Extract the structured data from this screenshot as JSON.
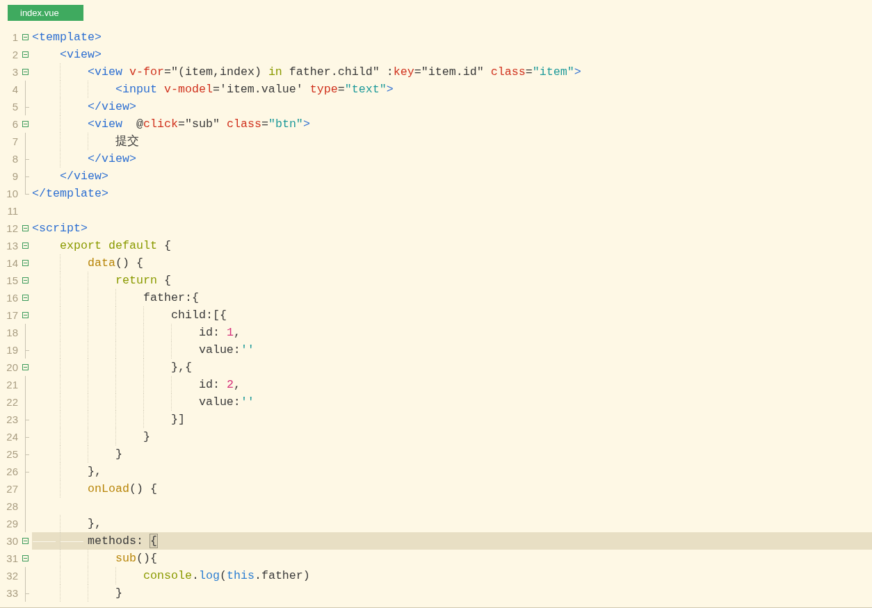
{
  "tab": {
    "label": "index.vue",
    "selected": true
  },
  "lines": [
    {
      "number": "1",
      "kind": "fold-start",
      "selected": false,
      "tokens": [
        {
          "kind": "tag",
          "text": "<template>"
        }
      ]
    },
    {
      "number": "2",
      "kind": "fold-start",
      "selected": false,
      "tokens": [
        {
          "kind": "tag",
          "text": "    <view>"
        }
      ]
    },
    {
      "number": "3",
      "kind": "fold-start",
      "selected": false,
      "tokens": [
        {
          "kind": "tag",
          "text": "        <view"
        },
        {
          "kind": "attr",
          "text": " v-for"
        },
        {
          "kind": "plain",
          "text": "=\"(item,index) "
        },
        {
          "kind": "keyword",
          "text": "in"
        },
        {
          "kind": "plain",
          "text": " father.child\" :"
        },
        {
          "kind": "attr",
          "text": "key"
        },
        {
          "kind": "plain",
          "text": "=\"item.id\" "
        },
        {
          "kind": "attr",
          "text": "class"
        },
        {
          "kind": "plain",
          "text": "="
        },
        {
          "kind": "string",
          "text": "\"item\""
        },
        {
          "kind": "tag",
          "text": ">"
        }
      ]
    },
    {
      "number": "4",
      "kind": "fold-inner",
      "selected": false,
      "tokens": [
        {
          "kind": "tag",
          "text": "            <input"
        },
        {
          "kind": "attr",
          "text": " v-model"
        },
        {
          "kind": "plain",
          "text": "='item.value' "
        },
        {
          "kind": "attr",
          "text": "type"
        },
        {
          "kind": "plain",
          "text": "="
        },
        {
          "kind": "string",
          "text": "\"text\""
        },
        {
          "kind": "tag",
          "text": ">"
        }
      ]
    },
    {
      "number": "5",
      "kind": "fold-end",
      "selected": false,
      "tokens": [
        {
          "kind": "tag",
          "text": "        </view>"
        }
      ]
    },
    {
      "number": "6",
      "kind": "fold-start",
      "selected": false,
      "tokens": [
        {
          "kind": "tag",
          "text": "        <view"
        },
        {
          "kind": "plain",
          "text": "  @"
        },
        {
          "kind": "attr",
          "text": "click"
        },
        {
          "kind": "plain",
          "text": "=\"sub\" "
        },
        {
          "kind": "attr",
          "text": "class"
        },
        {
          "kind": "plain",
          "text": "="
        },
        {
          "kind": "string",
          "text": "\"btn\""
        },
        {
          "kind": "tag",
          "text": ">"
        }
      ]
    },
    {
      "number": "7",
      "kind": "fold-inner",
      "selected": false,
      "tokens": [
        {
          "kind": "plain",
          "text": "            提交"
        }
      ]
    },
    {
      "number": "8",
      "kind": "fold-end",
      "selected": false,
      "tokens": [
        {
          "kind": "tag",
          "text": "        </view>"
        }
      ]
    },
    {
      "number": "9",
      "kind": "fold-end",
      "selected": false,
      "tokens": [
        {
          "kind": "tag",
          "text": "    </view>"
        }
      ]
    },
    {
      "number": "10",
      "kind": "fold-last",
      "selected": false,
      "tokens": [
        {
          "kind": "tag",
          "text": "</template>"
        }
      ]
    },
    {
      "number": "11",
      "kind": "blank",
      "selected": false
    },
    {
      "number": "12",
      "kind": "fold-start",
      "selected": false,
      "tokens": [
        {
          "kind": "tag",
          "text": "<script>"
        }
      ]
    },
    {
      "number": "13",
      "kind": "fold-start",
      "selected": false,
      "tokens": [
        {
          "kind": "keyword",
          "text": "    export default"
        },
        {
          "kind": "plain",
          "text": " {"
        }
      ]
    },
    {
      "number": "14",
      "kind": "fold-start",
      "selected": false,
      "tokens": [
        {
          "kind": "func",
          "text": "        data"
        },
        {
          "kind": "plain",
          "text": "() {"
        }
      ]
    },
    {
      "number": "15",
      "kind": "fold-start",
      "selected": false,
      "tokens": [
        {
          "kind": "keyword",
          "text": "            return"
        },
        {
          "kind": "plain",
          "text": " {"
        }
      ]
    },
    {
      "number": "16",
      "kind": "fold-start",
      "selected": false,
      "tokens": [
        {
          "kind": "plain",
          "text": "                father:{"
        }
      ]
    },
    {
      "number": "17",
      "kind": "fold-start",
      "selected": false,
      "tokens": [
        {
          "kind": "plain",
          "text": "                    child:[{"
        }
      ]
    },
    {
      "number": "18",
      "kind": "fold-inner",
      "selected": false,
      "tokens": [
        {
          "kind": "plain",
          "text": "                        id: "
        },
        {
          "kind": "number",
          "text": "1"
        },
        {
          "kind": "plain",
          "text": ","
        }
      ]
    },
    {
      "number": "19",
      "kind": "fold-end",
      "selected": false,
      "tokens": [
        {
          "kind": "plain",
          "text": "                        value:"
        },
        {
          "kind": "string",
          "text": "''"
        }
      ]
    },
    {
      "number": "20",
      "kind": "fold-start",
      "selected": false,
      "tokens": [
        {
          "kind": "plain",
          "text": "                    },{"
        }
      ]
    },
    {
      "number": "21",
      "kind": "fold-inner",
      "selected": false,
      "tokens": [
        {
          "kind": "plain",
          "text": "                        id: "
        },
        {
          "kind": "number",
          "text": "2"
        },
        {
          "kind": "plain",
          "text": ","
        }
      ]
    },
    {
      "number": "22",
      "kind": "fold-inner",
      "selected": false,
      "tokens": [
        {
          "kind": "plain",
          "text": "                        value:"
        },
        {
          "kind": "string",
          "text": "''"
        }
      ]
    },
    {
      "number": "23",
      "kind": "fold-end",
      "selected": false,
      "tokens": [
        {
          "kind": "plain",
          "text": "                    }]"
        }
      ]
    },
    {
      "number": "24",
      "kind": "fold-end",
      "selected": false,
      "tokens": [
        {
          "kind": "plain",
          "text": "                }"
        }
      ]
    },
    {
      "number": "25",
      "kind": "fold-end",
      "selected": false,
      "tokens": [
        {
          "kind": "plain",
          "text": "            }"
        }
      ]
    },
    {
      "number": "26",
      "kind": "fold-end",
      "selected": false,
      "tokens": [
        {
          "kind": "plain",
          "text": "        },"
        }
      ]
    },
    {
      "number": "27",
      "kind": "fold-inner",
      "selected": false,
      "tokens": [
        {
          "kind": "func",
          "text": "        onLoad"
        },
        {
          "kind": "plain",
          "text": "() {"
        }
      ]
    },
    {
      "number": "28",
      "kind": "fold-inner",
      "selected": false
    },
    {
      "number": "29",
      "kind": "fold-inner",
      "selected": false,
      "tokens": [
        {
          "kind": "plain",
          "text": "        },"
        }
      ]
    },
    {
      "number": "30",
      "kind": "fold-start",
      "selected": true,
      "tokens": [
        {
          "kind": "plain",
          "text": "        methods: "
        },
        {
          "kind": "bracket",
          "text": "{"
        }
      ]
    },
    {
      "number": "31",
      "kind": "fold-start",
      "selected": false,
      "tokens": [
        {
          "kind": "func",
          "text": "            sub"
        },
        {
          "kind": "plain",
          "text": "(){"
        }
      ]
    },
    {
      "number": "32",
      "kind": "fold-inner",
      "selected": false,
      "tokens": [
        {
          "kind": "keyword",
          "text": "                console"
        },
        {
          "kind": "plain",
          "text": "."
        },
        {
          "kind": "builtin",
          "text": "log"
        },
        {
          "kind": "plain",
          "text": "("
        },
        {
          "kind": "builtin",
          "text": "this"
        },
        {
          "kind": "plain",
          "text": ".father)"
        }
      ]
    },
    {
      "number": "33",
      "kind": "fold-end",
      "selected": false,
      "tokens": [
        {
          "kind": "plain",
          "text": "            }"
        }
      ]
    }
  ]
}
